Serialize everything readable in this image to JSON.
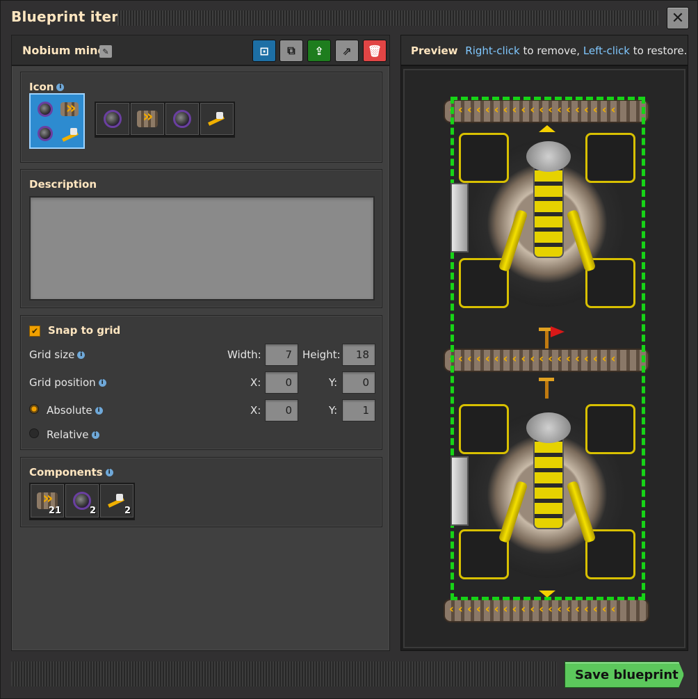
{
  "window": {
    "title": "Blueprint item",
    "close_label": "✕"
  },
  "blueprint": {
    "name": "Nobium mine",
    "edit_icon": "✎",
    "toolbar": [
      {
        "name": "select-area-button",
        "icon": "select-area-icon",
        "glyph": "⊡"
      },
      {
        "name": "copy-button",
        "icon": "copy-icon",
        "glyph": "⧉"
      },
      {
        "name": "reassign-button",
        "icon": "upload-icon",
        "glyph": "⇪"
      },
      {
        "name": "export-button",
        "icon": "export-icon",
        "glyph": "⇗"
      },
      {
        "name": "delete-button",
        "icon": "trash-icon",
        "glyph": "🗑"
      }
    ]
  },
  "icon_section": {
    "label": "Icon",
    "info": "i",
    "icons": [
      "ore-icon",
      "belt-icon",
      "ore-icon",
      "inserter-icon"
    ]
  },
  "description": {
    "label": "Description",
    "value": ""
  },
  "grid": {
    "snap_label": "Snap to grid",
    "snap_checked": true,
    "check_glyph": "✔",
    "grid_size_label": "Grid size",
    "width_label": "Width:",
    "width": "7",
    "height_label": "Height:",
    "height": "18",
    "grid_position_label": "Grid position",
    "pos_x_label": "X:",
    "pos_x": "0",
    "pos_y_label": "Y:",
    "pos_y": "0",
    "absolute_label": "Absolute",
    "abs_x_label": "X:",
    "abs_x": "0",
    "abs_y_label": "Y:",
    "abs_y": "1",
    "relative_label": "Relative",
    "selected_mode": "Absolute"
  },
  "components": {
    "label": "Components",
    "items": [
      {
        "icon": "belt-icon",
        "count": "21"
      },
      {
        "icon": "ore-icon",
        "count": "2"
      },
      {
        "icon": "inserter-icon",
        "count": "2"
      }
    ]
  },
  "preview": {
    "title": "Preview",
    "hint_key1": "Right-click",
    "hint_text1": " to remove, ",
    "hint_key2": "Left-click",
    "hint_text2": " to restore."
  },
  "footer": {
    "save_label": "Save blueprint"
  },
  "colors": {
    "accent_title": "#ffe6c0",
    "link_blue": "#80c8ff",
    "save_green": "#5cc85c",
    "delete_red": "#e14545",
    "frame_green": "#17d317"
  }
}
